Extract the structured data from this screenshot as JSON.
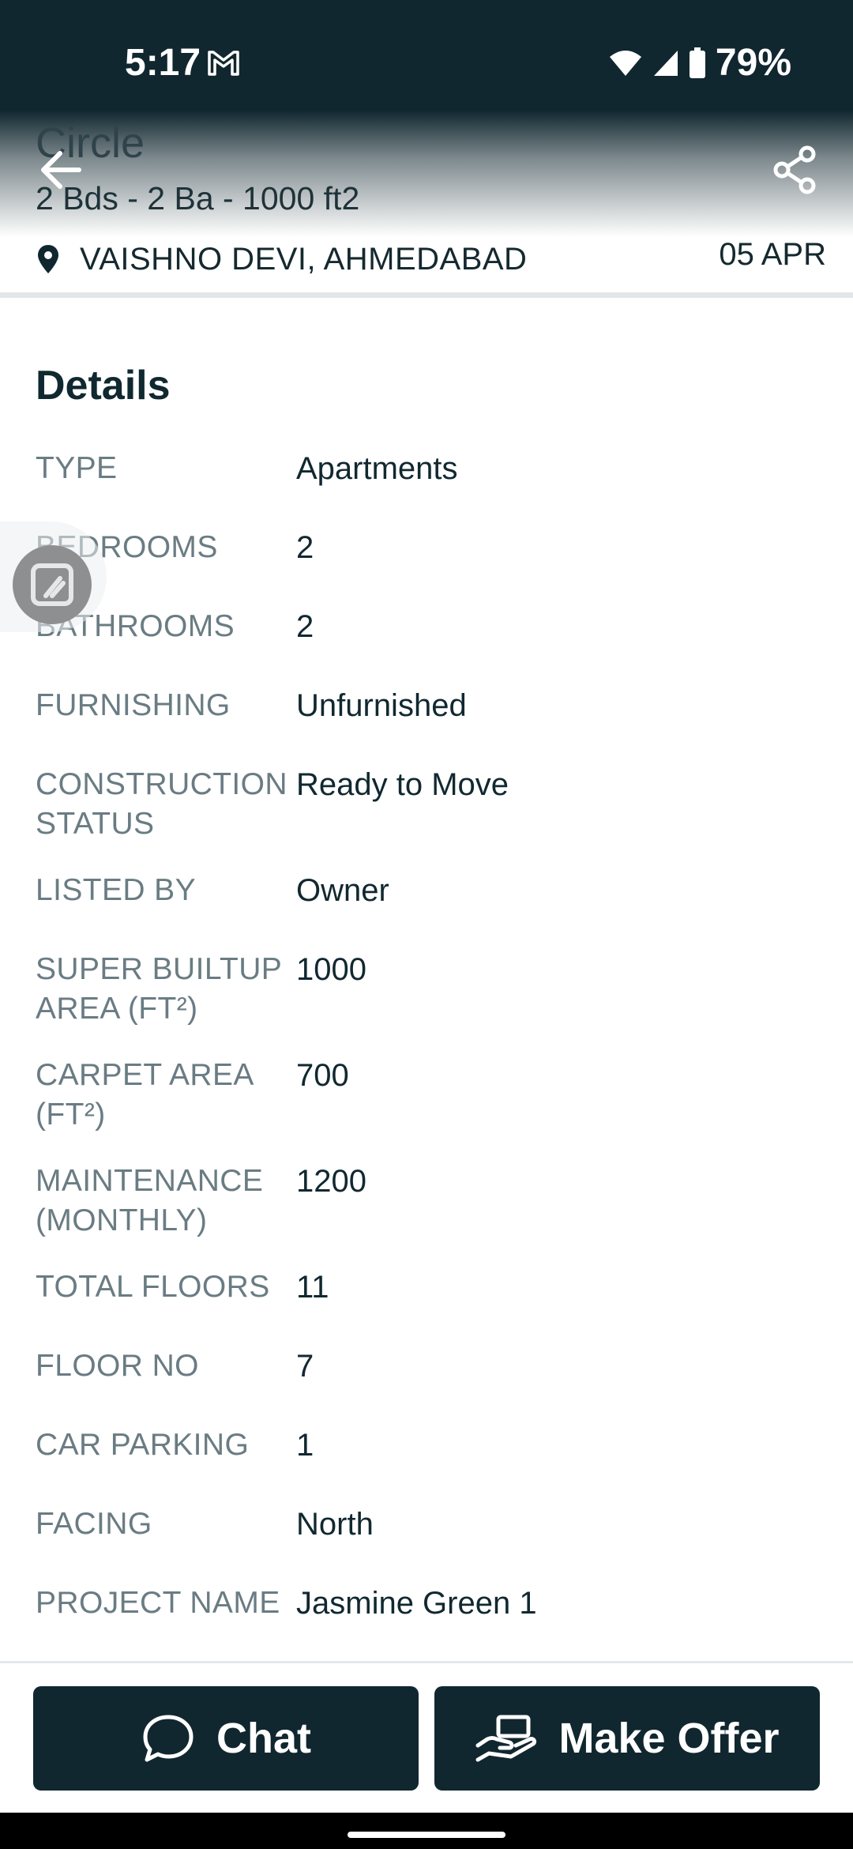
{
  "status_bar": {
    "time": "5:17",
    "battery": "79%"
  },
  "header": {
    "title": "Circle",
    "specs": "2 Bds - 2 Ba - 1000 ft2",
    "location": "VAISHNO DEVI, AHMEDABAD",
    "date": "05 APR"
  },
  "details": {
    "heading": "Details",
    "rows": [
      {
        "label": "TYPE",
        "value": "Apartments"
      },
      {
        "label": "BEDROOMS",
        "value": "2"
      },
      {
        "label": "BATHROOMS",
        "value": "2"
      },
      {
        "label": "FURNISHING",
        "value": "Unfurnished"
      },
      {
        "label": "CONSTRUCTION STATUS",
        "value": "Ready to Move"
      },
      {
        "label": "LISTED BY",
        "value": "Owner"
      },
      {
        "label": "SUPER BUILTUP AREA (FT²)",
        "value": "1000"
      },
      {
        "label": "CARPET AREA (FT²)",
        "value": "700"
      },
      {
        "label": "MAINTENANCE (MONTHLY)",
        "value": "1200"
      },
      {
        "label": "TOTAL FLOORS",
        "value": "11"
      },
      {
        "label": "FLOOR NO",
        "value": "7"
      },
      {
        "label": "CAR PARKING",
        "value": "1"
      },
      {
        "label": "FACING",
        "value": "North"
      },
      {
        "label": "PROJECT NAME",
        "value": "Jasmine Green 1"
      }
    ]
  },
  "actions": {
    "chat_label": "Chat",
    "offer_label": "Make Offer"
  },
  "icons": {
    "back": "arrow-left-icon",
    "share": "share-icon",
    "location": "location-pin-icon",
    "chat": "chat-bubble-icon",
    "offer": "hand-offer-icon",
    "mail": "gmail-icon",
    "wifi": "wifi-icon",
    "signal": "signal-icon",
    "battery": "battery-icon"
  },
  "colors": {
    "primary": "#11272f",
    "label_gray": "#6a7c83",
    "text": "#112830"
  }
}
